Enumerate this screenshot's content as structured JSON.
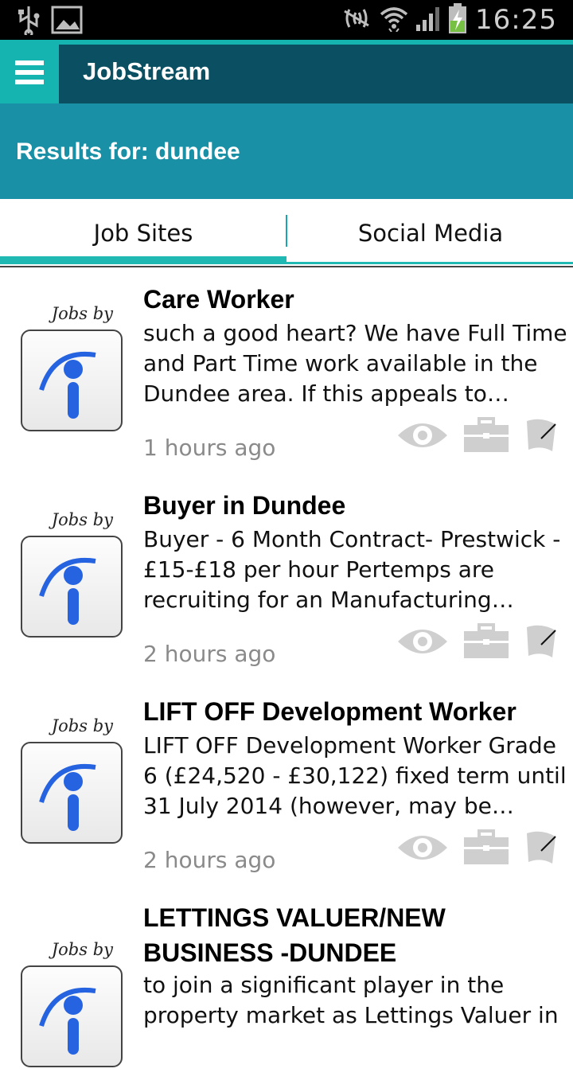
{
  "status_bar": {
    "time": "16:25",
    "icons": [
      "usb-icon",
      "image-icon",
      "nfc-muted-icon",
      "wifi-icon",
      "signal-icon",
      "battery-charging-icon"
    ]
  },
  "app_bar": {
    "menu_icon": "hamburger-menu-icon",
    "title": "JobStream",
    "colors": {
      "bar": "#0b4f62",
      "accent": "#15b4b0"
    }
  },
  "results": {
    "label": "Results for: dundee",
    "color": "#1a90a7"
  },
  "tabs": [
    {
      "label": "Job Sites",
      "active": true
    },
    {
      "label": "Social Media",
      "active": false
    }
  ],
  "jobs": [
    {
      "source_text": "Jobs by",
      "title": "Care Worker",
      "description": "such a good heart? We have Full Time and Part Time work available in the Dundee area. If this appeals to…",
      "time": "1 hours ago"
    },
    {
      "source_text": "Jobs by",
      "title": "Buyer in Dundee",
      "description": "Buyer - 6 Month Contract- Prestwick - £15-£18 per hour Pertemps are recruiting for an Manufacturing…",
      "time": "2 hours ago"
    },
    {
      "source_text": "Jobs by",
      "title": "LIFT OFF Development Worker",
      "description": "LIFT OFF Development Worker Grade 6 (£24,520 - £30,122) fixed term until 31 July 2014 (however, may be…",
      "time": "2 hours ago"
    },
    {
      "source_text": "Jobs by",
      "title": "LETTINGS VALUER/NEW BUSINESS -DUNDEE",
      "description": "to join a significant player in the property market as Lettings Valuer in",
      "time": ""
    }
  ],
  "action_icons": [
    "eye-icon",
    "briefcase-icon",
    "flag-icon"
  ]
}
